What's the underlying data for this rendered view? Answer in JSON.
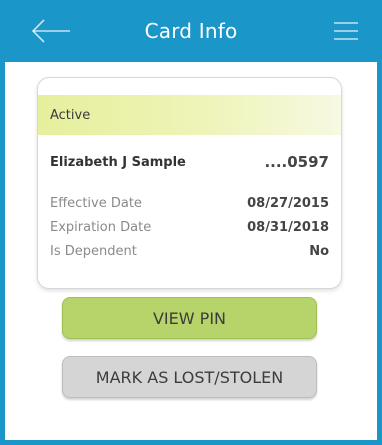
{
  "header": {
    "title": "Card Info",
    "back_icon": "arrow-left-icon",
    "menu_icon": "hamburger-menu-icon",
    "background": "#1a96c8"
  },
  "card": {
    "status": "Active",
    "member_name": "Elizabeth J Sample",
    "card_number": "....0597",
    "details": [
      {
        "label": "Effective Date",
        "value": "08/27/2015"
      },
      {
        "label": "Expiration Date",
        "value": "08/31/2018"
      },
      {
        "label": "Is Dependent",
        "value": "No"
      }
    ]
  },
  "actions": {
    "view_pin_label": "VIEW PIN",
    "view_pin_color": "#b6d46a",
    "mark_lost_label": "MARK AS LOST/STOLEN",
    "mark_lost_color": "#d5d5d5"
  }
}
